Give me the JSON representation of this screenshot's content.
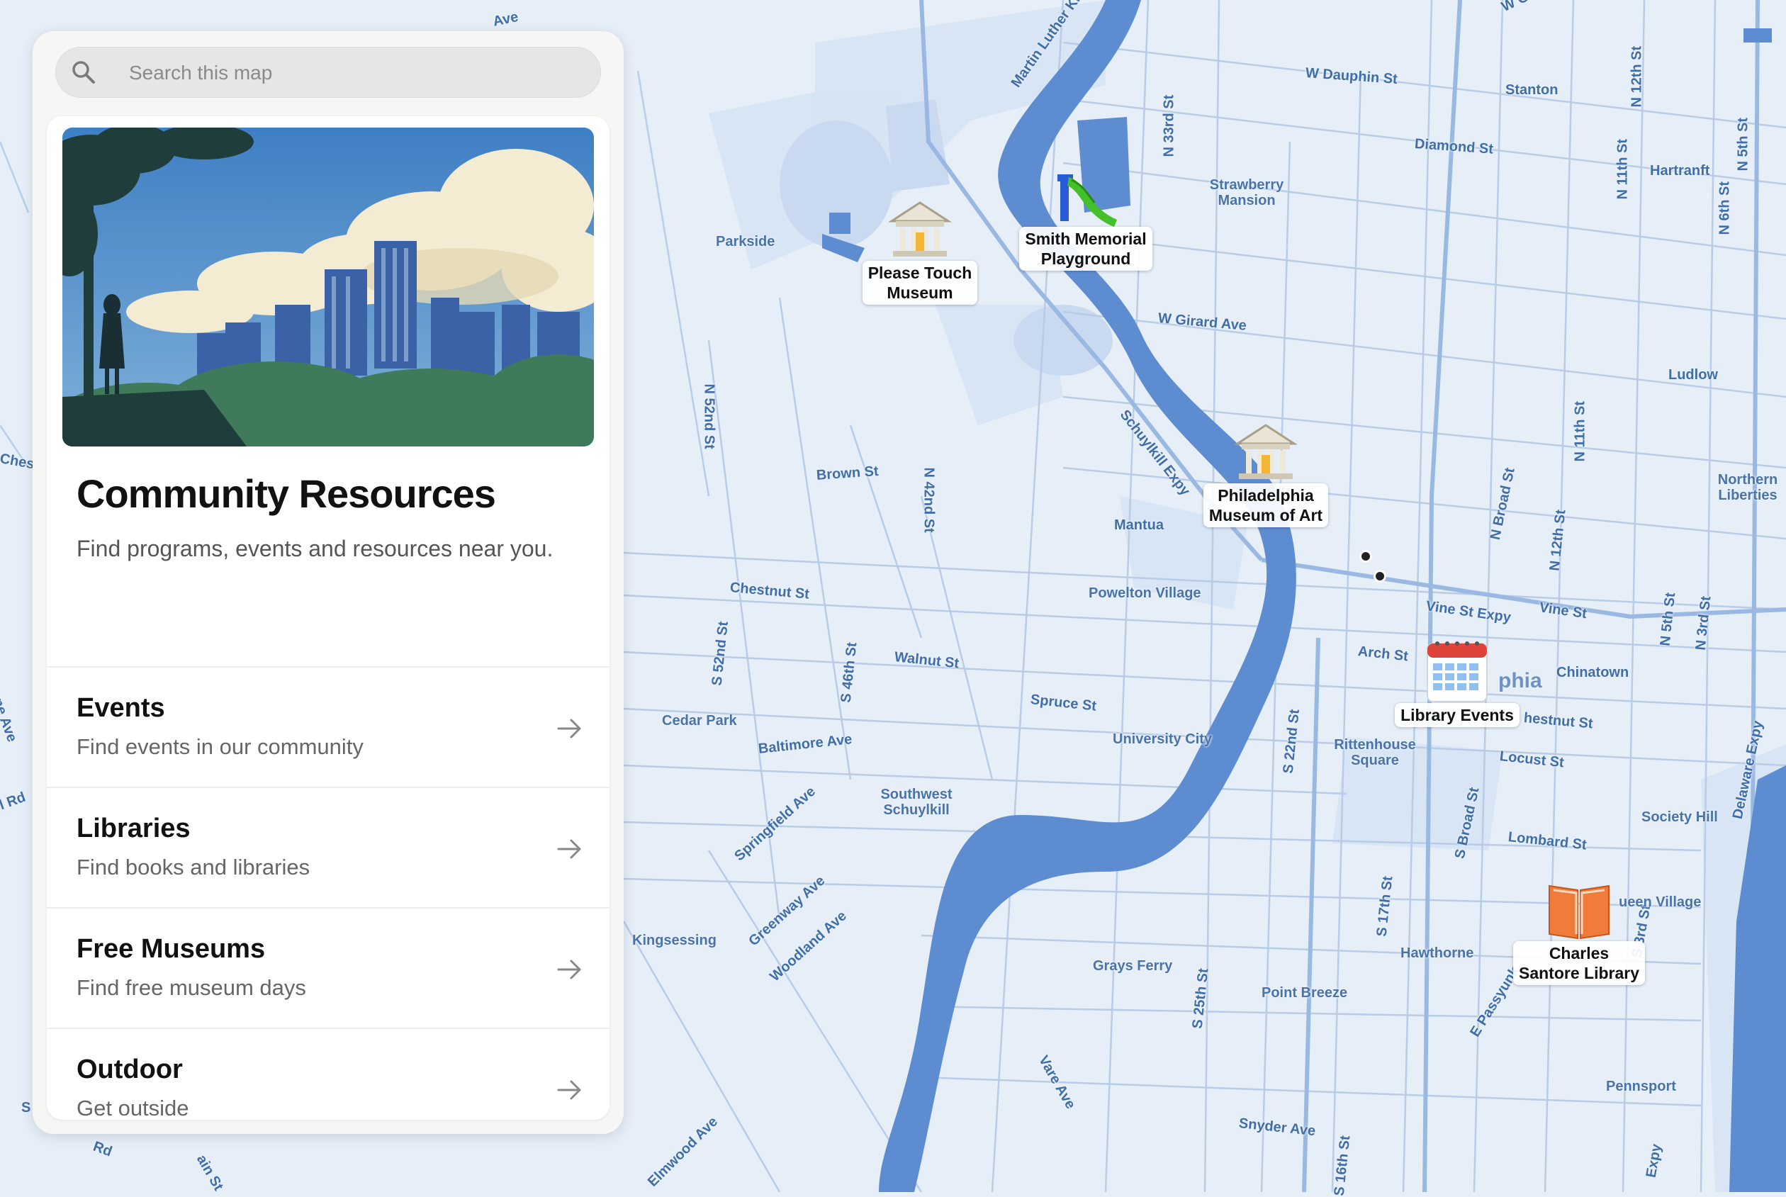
{
  "search": {
    "placeholder": "Search this map"
  },
  "panel": {
    "title": "Community Resources",
    "subtitle": "Find programs, events and resources near you.",
    "categories": [
      {
        "title": "Events",
        "subtitle": "Find events in our community"
      },
      {
        "title": "Libraries",
        "subtitle": "Find books and libraries"
      },
      {
        "title": "Free Museums",
        "subtitle": "Find free museum days"
      },
      {
        "title": "Outdoor",
        "subtitle": "Get outside"
      }
    ]
  },
  "map": {
    "pins": [
      {
        "label_line1": "Please Touch",
        "label_line2": "Museum",
        "icon": "museum-icon"
      },
      {
        "label_line1": "Smith Memorial",
        "label_line2": "Playground",
        "icon": "slide-icon"
      },
      {
        "label_line1": "Philadelphia",
        "label_line2": "Museum of Art",
        "icon": "museum-icon"
      },
      {
        "label_line1": "Library Events",
        "label_line2": "",
        "icon": "calendar-icon"
      },
      {
        "label_line1": "Charles",
        "label_line2": "Santore Library",
        "icon": "book-icon"
      }
    ],
    "streets": [
      "Martin Luther King",
      "W Dauphin St",
      "Stanton",
      "N 12th St",
      "Diamond St",
      "N 11th St",
      "Hartranft",
      "N 5th St",
      "N 6th St",
      "N 33rd St",
      "W Girard Ave",
      "Ludlow",
      "Schuylkill Expy",
      "N 11th St",
      "N 52nd St",
      "Brown St",
      "N 42nd St",
      "Mantua",
      "N Broad St",
      "N 12th St",
      "Chestnut St",
      "Vine St Expy",
      "Vine St",
      "N 5th St",
      "N 3rd St",
      "S 52nd St",
      "S 46th St",
      "Walnut St",
      "Arch St",
      "Chinatown",
      "Spruce St",
      "Baltimore Ave",
      "S 22nd St",
      "hestnut St",
      "Locust St",
      "Delaware Expy",
      "Springfield Ave",
      "S Broad St",
      "Lombard St",
      "Greenway Ave",
      "Woodland Ave",
      "S 17th St",
      "S 3rd St",
      "E Passyunk",
      "S 25th St",
      "Vare Ave",
      "Snyder Ave",
      "S 16th St",
      "Elmwood Ave",
      "W Glenwood",
      "Ave",
      "Chest",
      "wne Ave",
      "l Rd",
      "S",
      "Rd",
      "ain St",
      "Expy"
    ],
    "neighborhoods": [
      "Parkside",
      "Strawberry Mansion",
      "Northern Liberties",
      "Powelton Village",
      "Cedar Park",
      "University City",
      "Rittenhouse Square",
      "phia",
      "Southwest Schuylkill",
      "Society Hill",
      "Kingsessing",
      "ueen Village",
      "Hawthorne",
      "Grays Ferry",
      "Point Breeze",
      "Pennsport"
    ]
  }
}
